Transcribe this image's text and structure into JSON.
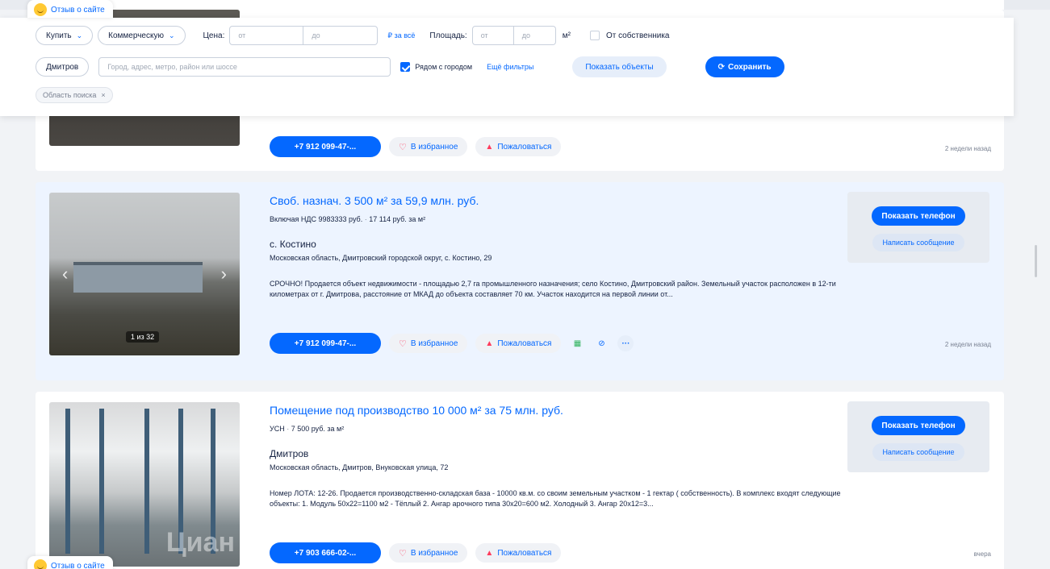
{
  "feedback": {
    "label": "Отзыв о сайте"
  },
  "filters": {
    "deal_type": "Купить",
    "property_type": "Коммерческую",
    "price_label": "Цена:",
    "price_from_placeholder": "от",
    "price_to_placeholder": "до",
    "price_unit_link": "₽ за всё",
    "area_label": "Площадь:",
    "area_from_placeholder": "от",
    "area_to_placeholder": "до",
    "area_unit": "м²",
    "owner_label": "От собственника",
    "city": "Дмитров",
    "search_placeholder": "Город, адрес, метро, район или шоссе",
    "near_city_label": "Рядом с городом",
    "more_filters": "Ещё фильтры",
    "show_objects": "Показать объекты",
    "save": "Сохранить",
    "search_area_tag": "Область поиска",
    "tag_close": "×"
  },
  "listings": [
    {
      "phone": "+7 912 099-47-...",
      "favorite": "В избранное",
      "report": "Пожаловаться",
      "date": "2 недели назад"
    },
    {
      "title": "Своб. назнач. 3 500 м² за 59,9 млн. руб.",
      "price_details": "Включая НДС 9983333 руб.",
      "price_per_m": "17 114 руб. за м²",
      "location": "с. Костино",
      "address": "Московская область, Дмитровский городской округ, с. Костино, 29",
      "description": "СРОЧНО! Продается объект недвижимости - площадью 2,7 га промышленного назначения; село Костино, Дмитровский район. Земельный участок расположен в 12-ти километрах от г. Дмитрова, расстояние от МКАД до объекта составляет 70 км. Участок находится на первой линии от...",
      "photo_counter": "1 из 32",
      "phone": "+7 912 099-47-...",
      "favorite": "В избранное",
      "report": "Пожаловаться",
      "more": "···",
      "date": "2 недели назад",
      "show_phone": "Показать телефон",
      "write_message": "Написать сообщение"
    },
    {
      "title": "Помещение под производство 10 000 м² за 75 млн. руб.",
      "price_details": "УСН",
      "price_per_m": "7 500 руб. за м²",
      "location": "Дмитров",
      "address": "Московская область, Дмитров, Внуковская улица, 72",
      "description": "Номер ЛОТА: 12-26. Продается производственно-складская база - 10000 кв.м. со своим земельным участком - 1 гектар ( собственность). В комплекс входят следующие объекты: 1. Модуль 50х22=1100 м2 - Тёплый 2. Ангар арочного типа 30х20=600 м2. Холодный 3. Ангар 20х12=3...",
      "watermark": "Циан",
      "phone": "+7 903 666-02-...",
      "favorite": "В избранное",
      "report": "Пожаловаться",
      "date": "вчера",
      "show_phone": "Показать телефон",
      "write_message": "Написать сообщение"
    }
  ],
  "colors": {
    "accent": "#0468ff",
    "highlight_bg": "#edf4ff",
    "text": "#152242",
    "danger": "#ff3b5c"
  }
}
